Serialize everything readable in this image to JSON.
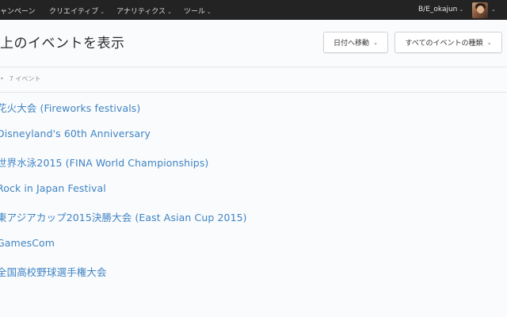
{
  "topbar": {
    "nav": [
      {
        "label": "ャンペーン",
        "has_dropdown": false
      },
      {
        "label": "クリエイティブ",
        "has_dropdown": true
      },
      {
        "label": "アナリティクス",
        "has_dropdown": true
      },
      {
        "label": "ツール",
        "has_dropdown": true
      }
    ],
    "account": {
      "label": "B/E_okajun",
      "has_dropdown": true
    },
    "avatar": {
      "icon": "user-avatar"
    }
  },
  "header": {
    "title": "上のイベントを表示",
    "date_button_label": "日付へ移動",
    "type_button_label": "すべてのイベントの種類"
  },
  "list_meta": {
    "count_label": "7 イベント"
  },
  "events": [
    "花火大会 (Fireworks festivals)",
    "Disneyland's 60th Anniversary",
    "世界水泳2015 (FINA World Championships)",
    "Rock in Japan Festival",
    "東アジアカップ2015決勝大会 (East Asian Cup 2015)",
    "GamesCom",
    "全国高校野球選手権大会"
  ],
  "colors": {
    "topbar_bg": "#232323",
    "page_bg": "#fafbfc",
    "link": "#3f84c4"
  }
}
